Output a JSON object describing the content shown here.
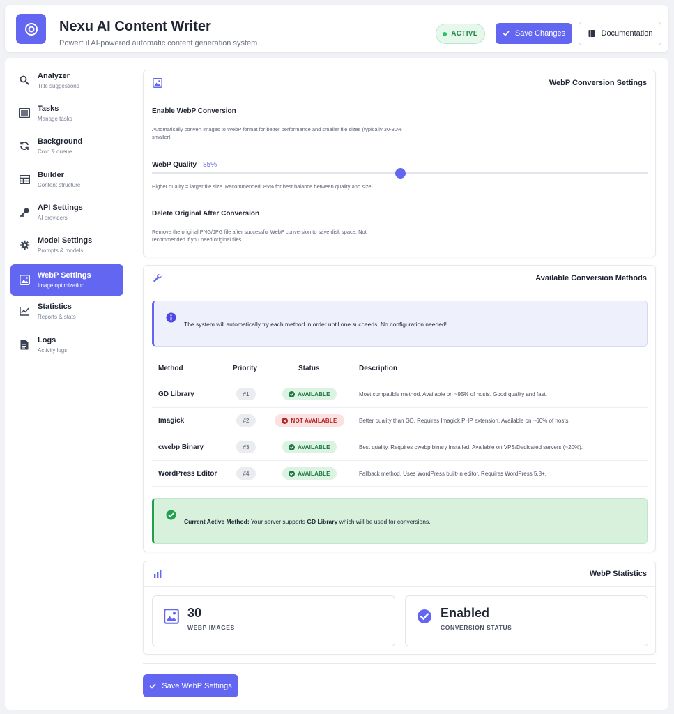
{
  "header": {
    "title": "Nexu AI Content Writer",
    "subtitle": "Powerful AI-powered automatic content generation system",
    "status_badge": "ACTIVE",
    "save_label": "Save Changes",
    "doc_label": "Documentation"
  },
  "sidebar": {
    "items": [
      {
        "label": "Analyzer",
        "sub": "Title suggestions",
        "icon": "search-icon"
      },
      {
        "label": "Tasks",
        "sub": "Manage tasks",
        "icon": "list-icon"
      },
      {
        "label": "Background",
        "sub": "Cron & queue",
        "icon": "sync-icon"
      },
      {
        "label": "Builder",
        "sub": "Content structure",
        "icon": "table-icon"
      },
      {
        "label": "API Settings",
        "sub": "AI providers",
        "icon": "key-icon"
      },
      {
        "label": "Model Settings",
        "sub": "Prompts & models",
        "icon": "gear-icon"
      },
      {
        "label": "WebP Settings",
        "sub": "Image optimization",
        "icon": "image-icon"
      },
      {
        "label": "Statistics",
        "sub": "Reports & stats",
        "icon": "chart-line-icon"
      },
      {
        "label": "Logs",
        "sub": "Activity logs",
        "icon": "file-icon"
      }
    ]
  },
  "webp_settings": {
    "title": "WebP Conversion Settings",
    "enable_title": "Enable WebP Conversion",
    "enable_desc": "Automatically convert images to WebP format for better performance and smaller file sizes (typically 30-80% smaller)",
    "quality_title": "WebP Quality",
    "quality_value": "85%",
    "quality_fraction": 0.5,
    "quality_desc": "Higher quality = larger file size. Recommended: 85% for best balance between quality and size",
    "delete_title": "Delete Original After Conversion",
    "delete_desc": "Remove the original PNG/JPG file after successful WebP conversion to save disk space. Not recommended if you need original files."
  },
  "methods": {
    "title": "Available Conversion Methods",
    "info": "The system will automatically try each method in order until one succeeds. No configuration needed!",
    "columns": [
      "Method",
      "Priority",
      "Status",
      "Description"
    ],
    "rows": [
      {
        "method": "GD Library",
        "priority": "#1",
        "status": "AVAILABLE",
        "ok": true,
        "desc": "Most compatible method. Available on ~95% of hosts. Good quality and fast."
      },
      {
        "method": "Imagick",
        "priority": "#2",
        "status": "NOT AVAILABLE",
        "ok": false,
        "desc": "Better quality than GD. Requires Imagick PHP extension. Available on ~60% of hosts."
      },
      {
        "method": "cwebp Binary",
        "priority": "#3",
        "status": "AVAILABLE",
        "ok": true,
        "desc": "Best quality. Requires cwebp binary installed. Available on VPS/Dedicated servers (~20%)."
      },
      {
        "method": "WordPress Editor",
        "priority": "#4",
        "status": "AVAILABLE",
        "ok": true,
        "desc": "Fallback method. Uses WordPress built-in editor. Requires WordPress 5.8+."
      }
    ],
    "current_label": "Current Active Method:",
    "current_pre": "Your server supports",
    "current_method": "GD Library",
    "current_post": "which will be used for conversions."
  },
  "stats": {
    "title": "WebP Statistics",
    "images_value": "30",
    "images_label": "WEBP IMAGES",
    "status_value": "Enabled",
    "status_label": "CONVERSION STATUS"
  },
  "footer": {
    "save_label": "Save WebP Settings"
  },
  "colors": {
    "accent": "#6366f1",
    "success": "#22a04b",
    "danger": "#b42323"
  }
}
